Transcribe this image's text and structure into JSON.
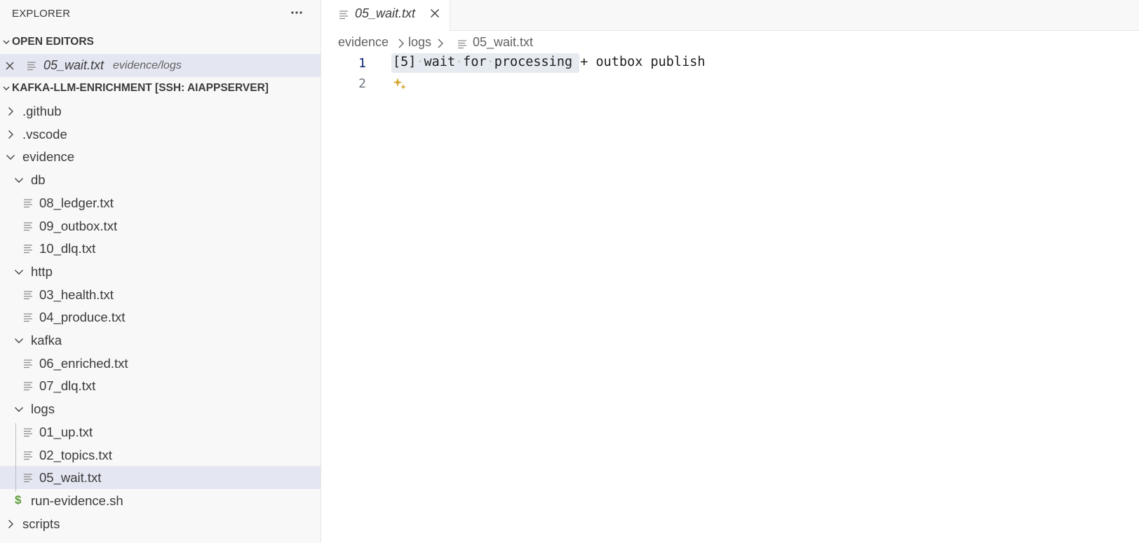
{
  "sidebar": {
    "title": "EXPLORER",
    "more_glyph": "···",
    "open_editors": {
      "header": "OPEN EDITORS",
      "items": [
        {
          "name": "05_wait.txt",
          "path": "evidence/logs"
        }
      ]
    },
    "workspace": {
      "header": "KAFKA-LLM-ENRICHMENT [SSH: AIAPPSERVER]",
      "tree": [
        {
          "label": ".github",
          "type": "folder",
          "expanded": false,
          "depth": 0
        },
        {
          "label": ".vscode",
          "type": "folder",
          "expanded": false,
          "depth": 0
        },
        {
          "label": "evidence",
          "type": "folder",
          "expanded": true,
          "depth": 0
        },
        {
          "label": "db",
          "type": "folder",
          "expanded": true,
          "depth": 1
        },
        {
          "label": "08_ledger.txt",
          "type": "file",
          "depth": 2
        },
        {
          "label": "09_outbox.txt",
          "type": "file",
          "depth": 2
        },
        {
          "label": "10_dlq.txt",
          "type": "file",
          "depth": 2
        },
        {
          "label": "http",
          "type": "folder",
          "expanded": true,
          "depth": 1
        },
        {
          "label": "03_health.txt",
          "type": "file",
          "depth": 2
        },
        {
          "label": "04_produce.txt",
          "type": "file",
          "depth": 2
        },
        {
          "label": "kafka",
          "type": "folder",
          "expanded": true,
          "depth": 1
        },
        {
          "label": "06_enriched.txt",
          "type": "file",
          "depth": 2
        },
        {
          "label": "07_dlq.txt",
          "type": "file",
          "depth": 2
        },
        {
          "label": "logs",
          "type": "folder",
          "expanded": true,
          "depth": 1
        },
        {
          "label": "01_up.txt",
          "type": "file",
          "depth": 2
        },
        {
          "label": "02_topics.txt",
          "type": "file",
          "depth": 2
        },
        {
          "label": "05_wait.txt",
          "type": "file",
          "depth": 2,
          "selected": true
        },
        {
          "label": "run-evidence.sh",
          "type": "shell",
          "depth": 1,
          "icon_glyph": "$"
        },
        {
          "label": "scripts",
          "type": "folder",
          "expanded": false,
          "depth": 0
        }
      ]
    }
  },
  "editor": {
    "tab": {
      "label": "05_wait.txt"
    },
    "breadcrumb": [
      "evidence",
      "logs",
      "05_wait.txt"
    ],
    "lines": [
      {
        "number": "1",
        "text": "[5] wait for processing + outbox publish"
      },
      {
        "number": "2",
        "text": ""
      }
    ]
  },
  "colors": {
    "selection_bg": "#e4e6f1",
    "sidebar_bg": "#f8f8f8",
    "sparkle": "#d4a72c",
    "shell_icon": "#5b9b3a",
    "active_line_number": "#0b216f"
  }
}
